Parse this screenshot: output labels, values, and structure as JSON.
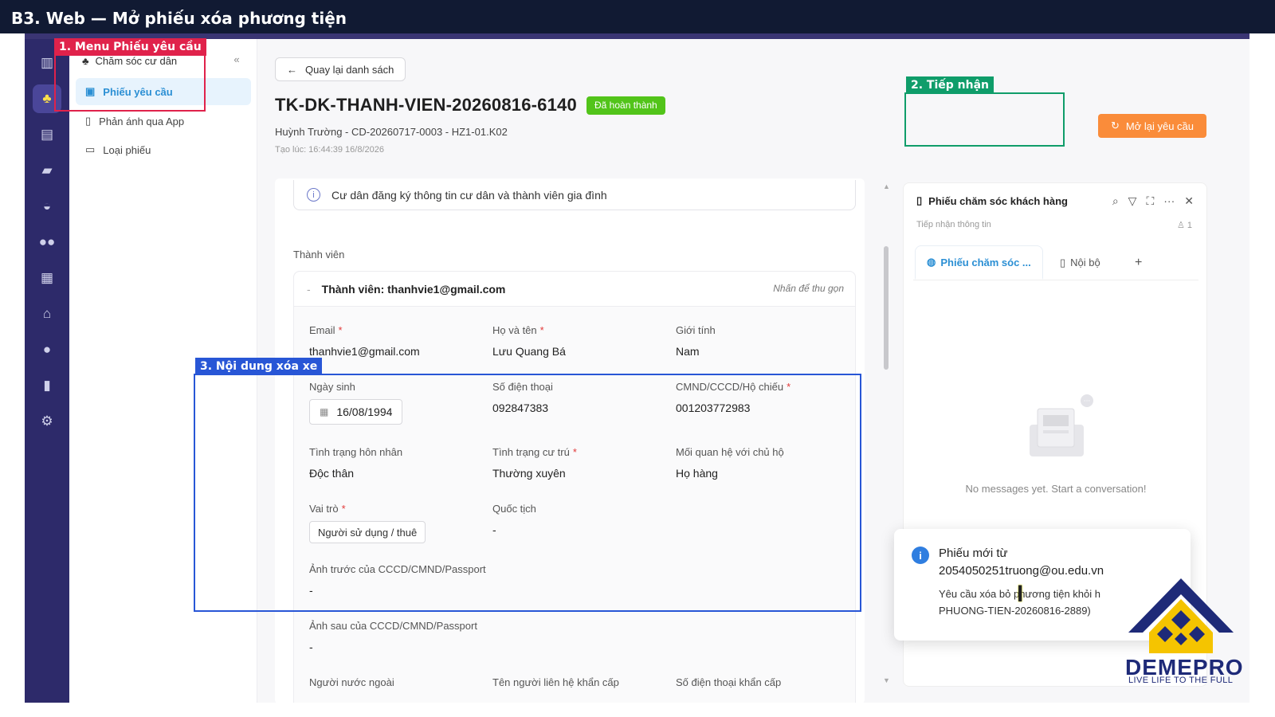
{
  "video": {
    "title": "B3. Web — Mở phiếu xóa phương tiện"
  },
  "annotations": {
    "menu_label": "1. Menu Phiếu yêu cầu",
    "receive_label": "2. Tiếp nhận",
    "content_label": "3. Nội dung xóa xe",
    "colors": {
      "menu": "#e0224b",
      "receive": "#0f9d6a",
      "content": "#2856d6"
    }
  },
  "submenu": {
    "header": "Chăm sóc cư dân",
    "items": [
      {
        "label": "Phiếu yêu cầu",
        "icon": "ticket-icon",
        "active": true
      },
      {
        "label": "Phản ánh qua App",
        "icon": "phone-icon",
        "active": false
      },
      {
        "label": "Loại phiếu",
        "icon": "category-icon",
        "active": false
      }
    ]
  },
  "iconbar": [
    {
      "icon": "building-icon",
      "glyph": "🏢"
    },
    {
      "icon": "resident-care-icon",
      "glyph": "♣",
      "active": true
    },
    {
      "icon": "calculator-icon",
      "glyph": "▤"
    },
    {
      "icon": "briefcase-icon",
      "glyph": "▰"
    },
    {
      "icon": "car-icon",
      "glyph": "🚗"
    },
    {
      "icon": "users-icon",
      "glyph": "👥"
    },
    {
      "icon": "apartment-icon",
      "glyph": "▦"
    },
    {
      "icon": "store-icon",
      "glyph": "⌂"
    },
    {
      "icon": "user-icon",
      "glyph": "👤"
    },
    {
      "icon": "chart-icon",
      "glyph": "▮"
    },
    {
      "icon": "settings-icon",
      "glyph": "⚙"
    }
  ],
  "ticket": {
    "back_label": "Quay lại danh sách",
    "id": "TK-DK-THANH-VIEN-20260816-6140",
    "status": "Đã hoàn thành",
    "subline": "Huỳnh Trường - CD-20260717-0003 - HZ1-01.K02",
    "created": "Tạo lúc: 16:44:39 16/8/2026",
    "reopen_label": "Mở lại yêu cầu",
    "info": "Cư dân đăng ký thông tin cư dân và thành viên gia đình",
    "members_label": "Thành viên",
    "member_title": "Thành viên: thanhvie1@gmail.com",
    "collapse_hint": "Nhấn để thu gọn"
  },
  "fields": {
    "email": {
      "label": "Email",
      "value": "thanhvie1@gmail.com"
    },
    "fullname": {
      "label": "Họ và tên",
      "value": "Lưu Quang Bá"
    },
    "gender": {
      "label": "Giới tính",
      "value": "Nam"
    },
    "dob": {
      "label": "Ngày sinh",
      "value": "16/08/1994"
    },
    "phone": {
      "label": "Số điện thoại",
      "value": "092847383"
    },
    "id_number": {
      "label": "CMND/CCCD/Hộ chiếu",
      "value": "001203772983"
    },
    "marital": {
      "label": "Tình trạng hôn nhân",
      "value": "Độc thân"
    },
    "residence": {
      "label": "Tình trạng cư trú",
      "value": "Thường xuyên"
    },
    "relation": {
      "label": "Mối quan hệ với chủ hộ",
      "value": "Họ hàng"
    },
    "role": {
      "label": "Vai trò",
      "value": "Người sử dụng / thuê"
    },
    "nationality": {
      "label": "Quốc tịch",
      "value": "-"
    },
    "id_front": {
      "label": "Ảnh trước của CCCD/CMND/Passport",
      "value": "-"
    },
    "id_back": {
      "label": "Ảnh sau của CCCD/CMND/Passport",
      "value": "-"
    },
    "foreigner": {
      "label": "Người nước ngoài"
    },
    "emergency_name": {
      "label": "Tên người liên hệ khẩn cấp"
    },
    "emergency_phone": {
      "label": "Số điện thoại khẩn cấp"
    }
  },
  "chat": {
    "title": "Phiếu chăm sóc khách hàng",
    "subtitle": "Tiếp nhận thông tin",
    "participants": "1",
    "tab_active": "Phiếu chăm sóc ...",
    "tab_internal": "Nội bộ",
    "tab_add": "+",
    "empty": "No messages yet. Start a conversation!"
  },
  "toast": {
    "line1": "Phiếu mới từ",
    "line2": "2054050251truong@ou.edu.vn",
    "line3": "Yêu cầu xóa bỏ phương tiện khỏi h",
    "line4": "PHUONG-TIEN-20260816-2889)"
  },
  "brand": {
    "name": "DEMEPRO",
    "tagline": "LIVE LIFE TO THE FULL",
    "colors": {
      "navy": "#1e2a78",
      "gold": "#f5c400"
    }
  }
}
